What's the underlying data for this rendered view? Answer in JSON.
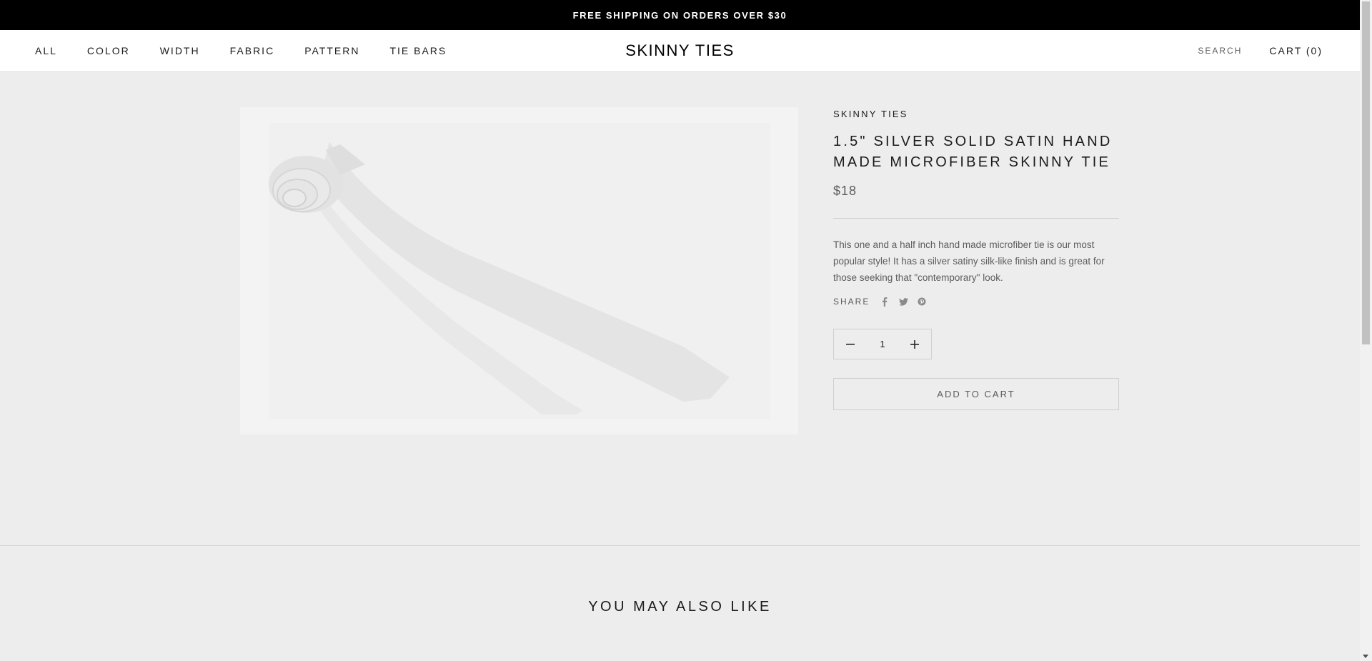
{
  "announcement": "FREE SHIPPING ON ORDERS OVER $30",
  "nav": {
    "items": [
      "ALL",
      "COLOR",
      "WIDTH",
      "FABRIC",
      "PATTERN",
      "TIE BARS"
    ]
  },
  "brand": "SKINNY TIES",
  "header": {
    "search_label": "SEARCH",
    "cart_label": "CART (0)"
  },
  "product": {
    "vendor": "SKINNY TIES",
    "title": "1.5\" SILVER SOLID SATIN HAND MADE MICROFIBER SKINNY TIE",
    "price": "$18",
    "description": "This one and a half inch hand made microfiber tie is our most popular style! It has a silver satiny silk-like finish and is great for those seeking that \"contemporary\" look.",
    "share_label": "SHARE",
    "share_icons": [
      "facebook-icon",
      "twitter-icon",
      "pinterest-icon"
    ],
    "quantity": "1",
    "add_to_cart": "ADD TO CART"
  },
  "related": {
    "title": "YOU MAY ALSO LIKE"
  }
}
